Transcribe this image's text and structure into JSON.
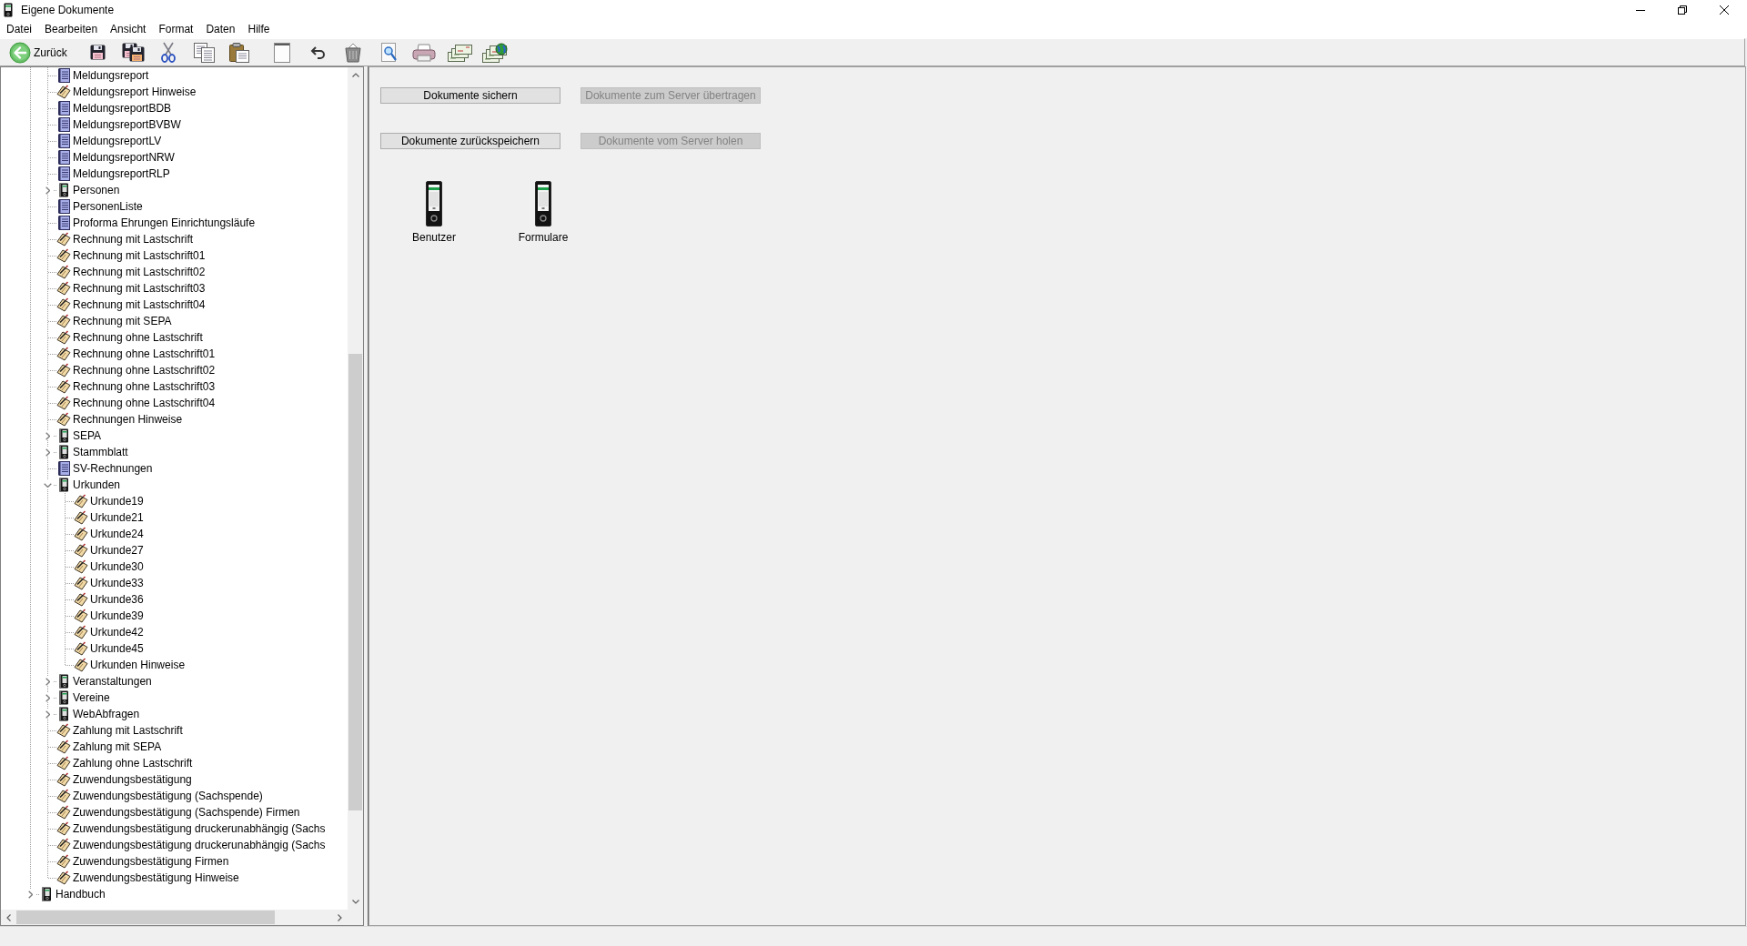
{
  "window": {
    "title": "Eigene Dokumente"
  },
  "menu": [
    {
      "label": "Datei"
    },
    {
      "label": "Bearbeiten"
    },
    {
      "label": "Ansicht"
    },
    {
      "label": "Format"
    },
    {
      "label": "Daten"
    },
    {
      "label": "Hilfe"
    }
  ],
  "toolbar": {
    "back_button": {
      "label": "Zurück"
    }
  },
  "tree": {
    "items": [
      {
        "expanded": true,
        "children": [
          {
            "label": "Meldungsreport",
            "kind": "report"
          },
          {
            "label": "Meldungsreport Hinweise",
            "kind": "form"
          },
          {
            "label": "MeldungsreportBDB",
            "kind": "report"
          },
          {
            "label": "MeldungsreportBVBW",
            "kind": "report"
          },
          {
            "label": "MeldungsreportLV",
            "kind": "report"
          },
          {
            "label": "MeldungsreportNRW",
            "kind": "report"
          },
          {
            "label": "MeldungsreportRLP",
            "kind": "report"
          },
          {
            "label": "Personen",
            "kind": "binder",
            "expanded": false
          },
          {
            "label": "PersonenListe",
            "kind": "report"
          },
          {
            "label": "Proforma Ehrungen Einrichtungsläufe",
            "kind": "report"
          },
          {
            "label": "Rechnung mit Lastschrift",
            "kind": "form"
          },
          {
            "label": "Rechnung mit Lastschrift01",
            "kind": "form"
          },
          {
            "label": "Rechnung mit Lastschrift02",
            "kind": "form"
          },
          {
            "label": "Rechnung mit Lastschrift03",
            "kind": "form"
          },
          {
            "label": "Rechnung mit Lastschrift04",
            "kind": "form"
          },
          {
            "label": "Rechnung mit SEPA",
            "kind": "form"
          },
          {
            "label": "Rechnung ohne Lastschrift",
            "kind": "form"
          },
          {
            "label": "Rechnung ohne Lastschrift01",
            "kind": "form"
          },
          {
            "label": "Rechnung ohne Lastschrift02",
            "kind": "form"
          },
          {
            "label": "Rechnung ohne Lastschrift03",
            "kind": "form"
          },
          {
            "label": "Rechnung ohne Lastschrift04",
            "kind": "form"
          },
          {
            "label": "Rechnungen Hinweise",
            "kind": "form"
          },
          {
            "label": "SEPA",
            "kind": "binder",
            "expanded": false
          },
          {
            "label": "Stammblatt",
            "kind": "binder",
            "expanded": false
          },
          {
            "label": "SV-Rechnungen",
            "kind": "report"
          },
          {
            "label": "Urkunden",
            "kind": "binder",
            "expanded": true,
            "children": [
              {
                "label": "Urkunde19",
                "kind": "form"
              },
              {
                "label": "Urkunde21",
                "kind": "form"
              },
              {
                "label": "Urkunde24",
                "kind": "form"
              },
              {
                "label": "Urkunde27",
                "kind": "form"
              },
              {
                "label": "Urkunde30",
                "kind": "form"
              },
              {
                "label": "Urkunde33",
                "kind": "form"
              },
              {
                "label": "Urkunde36",
                "kind": "form"
              },
              {
                "label": "Urkunde39",
                "kind": "form"
              },
              {
                "label": "Urkunde42",
                "kind": "form"
              },
              {
                "label": "Urkunde45",
                "kind": "form"
              },
              {
                "label": "Urkunden Hinweise",
                "kind": "form"
              }
            ]
          },
          {
            "label": "Veranstaltungen",
            "kind": "binder",
            "expanded": false
          },
          {
            "label": "Vereine",
            "kind": "binder",
            "expanded": false
          },
          {
            "label": "WebAbfragen",
            "kind": "binder",
            "expanded": false
          },
          {
            "label": "Zahlung mit Lastschrift",
            "kind": "form"
          },
          {
            "label": "Zahlung mit SEPA",
            "kind": "form"
          },
          {
            "label": "Zahlung ohne Lastschrift",
            "kind": "form"
          },
          {
            "label": "Zuwendungsbestätigung",
            "kind": "form"
          },
          {
            "label": "Zuwendungsbestätigung (Sachspende)",
            "kind": "form"
          },
          {
            "label": "Zuwendungsbestätigung (Sachspende) Firmen",
            "kind": "form"
          },
          {
            "label": "Zuwendungsbestätigung druckerunabhängig (Sachs",
            "kind": "form"
          },
          {
            "label": "Zuwendungsbestätigung druckerunabhängig (Sachs",
            "kind": "form"
          },
          {
            "label": "Zuwendungsbestätigung Firmen",
            "kind": "form"
          },
          {
            "label": "Zuwendungsbestätigung Hinweise",
            "kind": "form"
          }
        ]
      },
      {
        "label": "Handbuch",
        "kind": "binder",
        "expanded": false
      }
    ]
  },
  "actions": [
    {
      "label": "Dokumente sichern",
      "disabled": false
    },
    {
      "label": "Dokumente zum Server übertragen",
      "disabled": true
    },
    {
      "label": "Dokumente zurückspeichern",
      "disabled": false
    },
    {
      "label": "Dokumente vom Server holen",
      "disabled": true
    }
  ],
  "folders": [
    {
      "label": "Benutzer"
    },
    {
      "label": "Formulare"
    }
  ]
}
